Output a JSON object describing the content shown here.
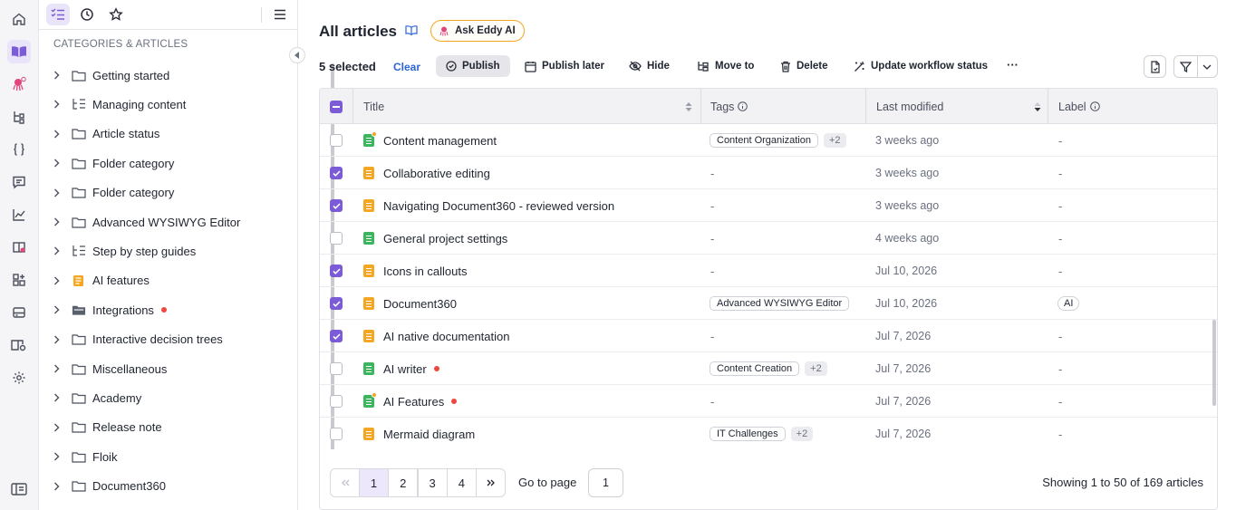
{
  "rail": {
    "icons": [
      "home-icon",
      "knowledge-base-icon",
      "eddy-ai-icon",
      "workflow-icon",
      "api-docs-icon",
      "feedback-icon",
      "analytics-icon",
      "widget-icon",
      "integrations-icon",
      "drive-icon",
      "portal-icon",
      "settings-icon",
      "collapse-panel-icon"
    ]
  },
  "tree": {
    "header": "CATEGORIES & ARTICLES",
    "items": [
      {
        "label": "Getting started",
        "icon": "folder-icon",
        "dot": false
      },
      {
        "label": "Managing content",
        "icon": "tree-icon",
        "dot": false
      },
      {
        "label": "Article status",
        "icon": "folder-icon",
        "dot": false
      },
      {
        "label": "Folder category",
        "icon": "folder-icon",
        "dot": false
      },
      {
        "label": "Folder category",
        "icon": "folder-icon",
        "dot": false
      },
      {
        "label": "Advanced WYSIWYG Editor",
        "icon": "folder-icon",
        "dot": false
      },
      {
        "label": "Step by step guides",
        "icon": "tree-icon",
        "dot": false
      },
      {
        "label": "AI features",
        "icon": "scroll-icon",
        "dot": false
      },
      {
        "label": "Integrations",
        "icon": "folder-filled-icon",
        "dot": true
      },
      {
        "label": "Interactive decision trees",
        "icon": "folder-icon",
        "dot": false
      },
      {
        "label": "Miscellaneous",
        "icon": "folder-icon",
        "dot": false
      },
      {
        "label": "Academy",
        "icon": "folder-icon",
        "dot": false
      },
      {
        "label": "Release note",
        "icon": "folder-icon",
        "dot": false
      },
      {
        "label": "Floik",
        "icon": "folder-icon",
        "dot": false
      },
      {
        "label": "Document360",
        "icon": "folder-icon",
        "dot": false
      }
    ]
  },
  "main": {
    "title": "All articles",
    "eddy_label": "Ask Eddy AI",
    "selected": "5 selected",
    "clear": "Clear",
    "actions": {
      "publish": "Publish",
      "publish_later": "Publish later",
      "hide": "Hide",
      "move_to": "Move to",
      "delete": "Delete",
      "workflow": "Update workflow status",
      "more": "···"
    }
  },
  "table": {
    "columns": {
      "title": "Title",
      "tags": "Tags",
      "modified": "Last modified",
      "label": "Label"
    },
    "rows": [
      {
        "title": "Content management",
        "checked": false,
        "color": "#3bb55e",
        "badge": true,
        "dot": false,
        "tag": "Content Organization",
        "plus": "+2",
        "modified": "3 weeks ago",
        "label": "-"
      },
      {
        "title": "Collaborative editing",
        "checked": true,
        "color": "#f5a623",
        "badge": false,
        "dot": false,
        "tag": "",
        "plus": "",
        "modified": "3 weeks ago",
        "label": "-"
      },
      {
        "title": "Navigating Document360 - reviewed version",
        "checked": true,
        "color": "#f5a623",
        "badge": false,
        "dot": false,
        "tag": "",
        "plus": "",
        "modified": "3 weeks ago",
        "label": "-"
      },
      {
        "title": "General project settings",
        "checked": false,
        "color": "#3bb55e",
        "badge": false,
        "dot": false,
        "tag": "",
        "plus": "",
        "modified": "4 weeks ago",
        "label": "-"
      },
      {
        "title": "Icons in callouts",
        "checked": true,
        "color": "#f5a623",
        "badge": false,
        "dot": false,
        "tag": "",
        "plus": "",
        "modified": "Jul 10, 2026",
        "label": "-"
      },
      {
        "title": "Document360",
        "checked": true,
        "color": "#f5a623",
        "badge": false,
        "dot": false,
        "tag": "Advanced WYSIWYG Editor",
        "plus": "",
        "modified": "Jul 10, 2026",
        "label": "AI"
      },
      {
        "title": "AI native documentation",
        "checked": true,
        "color": "#f5a623",
        "badge": false,
        "dot": false,
        "tag": "",
        "plus": "",
        "modified": "Jul 7, 2026",
        "label": "-"
      },
      {
        "title": "AI writer",
        "checked": false,
        "color": "#3bb55e",
        "badge": false,
        "dot": true,
        "tag": "Content Creation",
        "plus": "+2",
        "modified": "Jul 7, 2026",
        "label": "-"
      },
      {
        "title": "AI Features",
        "checked": false,
        "color": "#3bb55e",
        "badge": true,
        "dot": true,
        "tag": "",
        "plus": "",
        "modified": "Jul 7, 2026",
        "label": "-"
      },
      {
        "title": "Mermaid diagram",
        "checked": false,
        "color": "#f5a623",
        "badge": false,
        "dot": false,
        "tag": "IT Challenges",
        "plus": "+2",
        "modified": "Jul 7, 2026",
        "label": "-"
      }
    ],
    "empty_value": "-"
  },
  "pager": {
    "pages": [
      "1",
      "2",
      "3",
      "4"
    ],
    "current": "1",
    "goto_label": "Go to page",
    "goto_value": "1",
    "showing": "Showing 1 to 50 of 169 articles"
  },
  "colors": {
    "accent": "#7c5cd6",
    "link": "#2b63d9",
    "eddy_border": "#f5a623",
    "published": "#3bb55e",
    "draft": "#f5a623",
    "alert": "#f0473d"
  }
}
